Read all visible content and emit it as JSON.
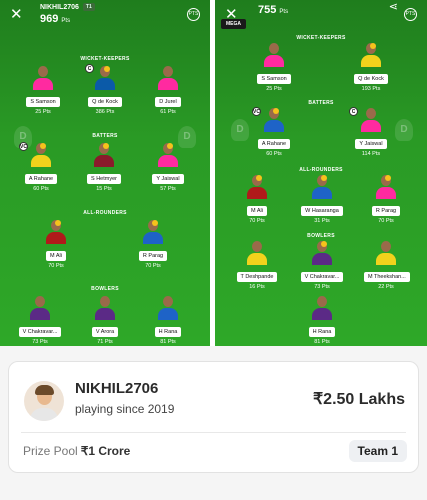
{
  "left_panel": {
    "team_name": "NIKHIL2706",
    "team_tag": "T1",
    "points": "969",
    "points_unit": "Pts",
    "sections": {
      "wk": "WICKET-KEEPERS",
      "bat": "BATTERS",
      "ar": "ALL-ROUNDERS",
      "bowl": "BOWLERS"
    },
    "players": [
      {
        "name": "S Samson",
        "pts": "25 Pts",
        "color": "#ff2aa0"
      },
      {
        "name": "Q de Kock",
        "pts": "386 Pts",
        "color": "#0b5aa8",
        "role": "C"
      },
      {
        "name": "D Jurel",
        "pts": "61 Pts",
        "color": "#ff2aa0"
      },
      {
        "name": "A Rahane",
        "pts": "60 Pts",
        "color": "#f2d21c",
        "role": "VC"
      },
      {
        "name": "S Hetmyer",
        "pts": "15 Pts",
        "color": "#8a1b2b"
      },
      {
        "name": "Y Jaiswal",
        "pts": "57 Pts",
        "color": "#ff2aa0"
      },
      {
        "name": "M Ali",
        "pts": "70 Pts",
        "color": "#b01a1a"
      },
      {
        "name": "R Parag",
        "pts": "70 Pts",
        "color": "#1e63c7"
      },
      {
        "name": "V Chakravar...",
        "pts": "73 Pts",
        "color": "#5b2a86"
      },
      {
        "name": "V Arora",
        "pts": "71 Pts",
        "color": "#5b2a86"
      },
      {
        "name": "H Rana",
        "pts": "81 Pts",
        "color": "#1e63c7"
      }
    ]
  },
  "right_panel": {
    "points": "755",
    "points_unit": "Pts",
    "badge": "MEGA",
    "sections": {
      "wk": "WICKET-KEEPERS",
      "bat": "BATTERS",
      "ar": "ALL-ROUNDERS",
      "bowl": "BOWLERS"
    },
    "players": [
      {
        "name": "S Samson",
        "pts": "25 Pts",
        "color": "#ff2aa0"
      },
      {
        "name": "Q de Kock",
        "pts": "193 Pts",
        "color": "#f2d21c"
      },
      {
        "name": "A Rahane",
        "pts": "60 Pts",
        "color": "#1e63c7",
        "role": "VC"
      },
      {
        "name": "Y Jaiswal",
        "pts": "114 Pts",
        "color": "#ff2aa0",
        "role": "C"
      },
      {
        "name": "M Ali",
        "pts": "70 Pts",
        "color": "#b01a1a"
      },
      {
        "name": "W Hasaranga",
        "pts": "31 Pts",
        "color": "#1e63c7"
      },
      {
        "name": "R Parag",
        "pts": "70 Pts",
        "color": "#ff2aa0"
      },
      {
        "name": "T Deshpande",
        "pts": "16 Pts",
        "color": "#f2d21c"
      },
      {
        "name": "V Chakravar...",
        "pts": "73 Pts",
        "color": "#5b2a86"
      },
      {
        "name": "M Theekshan...",
        "pts": "22 Pts",
        "color": "#f2d21c"
      },
      {
        "name": "H Rana",
        "pts": "81 Pts",
        "color": "#5b2a86"
      }
    ]
  },
  "card": {
    "username": "NIKHIL2706",
    "since": "playing since 2019",
    "amount": "₹2.50 Lakhs",
    "prize_label": "Prize Pool",
    "prize_value": "₹1 Crore",
    "team": "Team 1"
  },
  "icons": {
    "close": "close-icon",
    "pts": "points-badge-icon",
    "share": "share-icon",
    "trophy": "trophy-watermark-icon"
  }
}
